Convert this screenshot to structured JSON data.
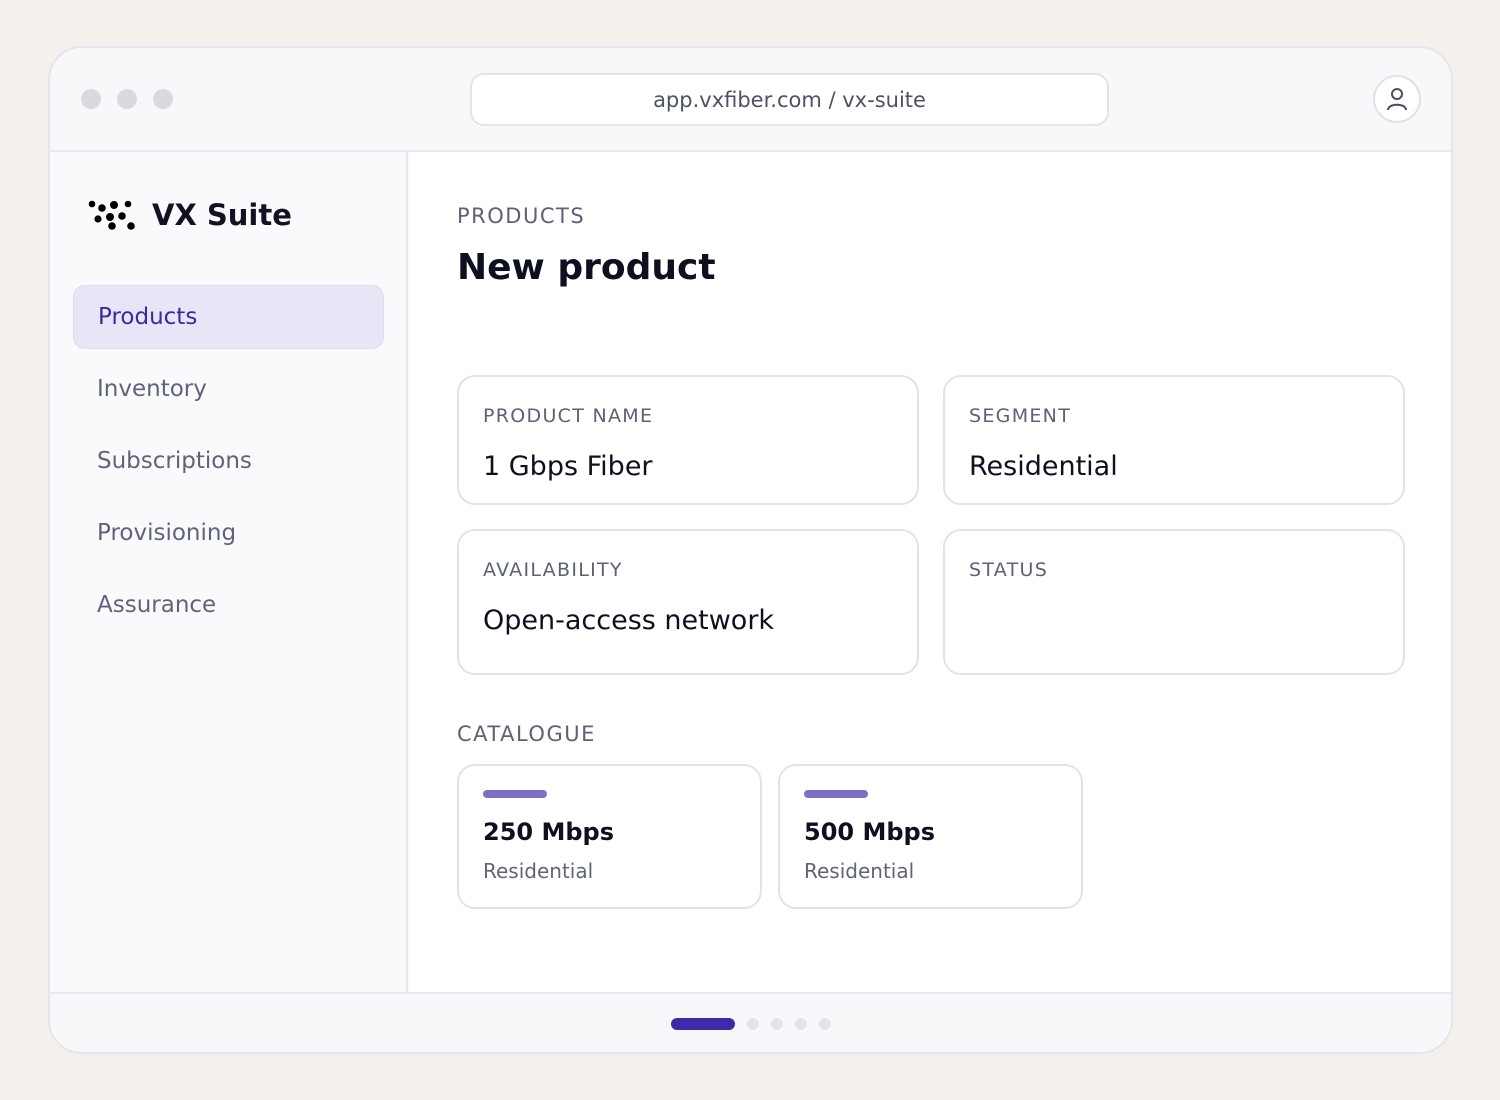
{
  "browser": {
    "url": "app.vxfiber.com / vx-suite"
  },
  "brand": {
    "name": "VX Suite"
  },
  "sidebar": {
    "items": [
      {
        "label": "Products",
        "active": true
      },
      {
        "label": "Inventory",
        "active": false
      },
      {
        "label": "Subscriptions",
        "active": false
      },
      {
        "label": "Provisioning",
        "active": false
      },
      {
        "label": "Assurance",
        "active": false
      }
    ]
  },
  "page": {
    "eyebrow": "PRODUCTS",
    "title": "New product"
  },
  "form": {
    "product_name": {
      "label": "PRODUCT NAME",
      "value": "1 Gbps Fiber"
    },
    "segment": {
      "label": "SEGMENT",
      "value": "Residential"
    },
    "availability": {
      "label": "AVAILABILITY",
      "value": "Open-access network"
    },
    "status": {
      "label": "STATUS",
      "value": ""
    }
  },
  "catalogue": {
    "label": "CATALOGUE",
    "items": [
      {
        "name": "250 Mbps",
        "segment": "Residential"
      },
      {
        "name": "500 Mbps",
        "segment": "Residential"
      }
    ]
  },
  "pager": {
    "count": 5,
    "current": 1
  },
  "colors": {
    "accent": "#4128a8",
    "nav_active_bg": "#e8e6f6",
    "card_bar": "#7d6fc8"
  }
}
